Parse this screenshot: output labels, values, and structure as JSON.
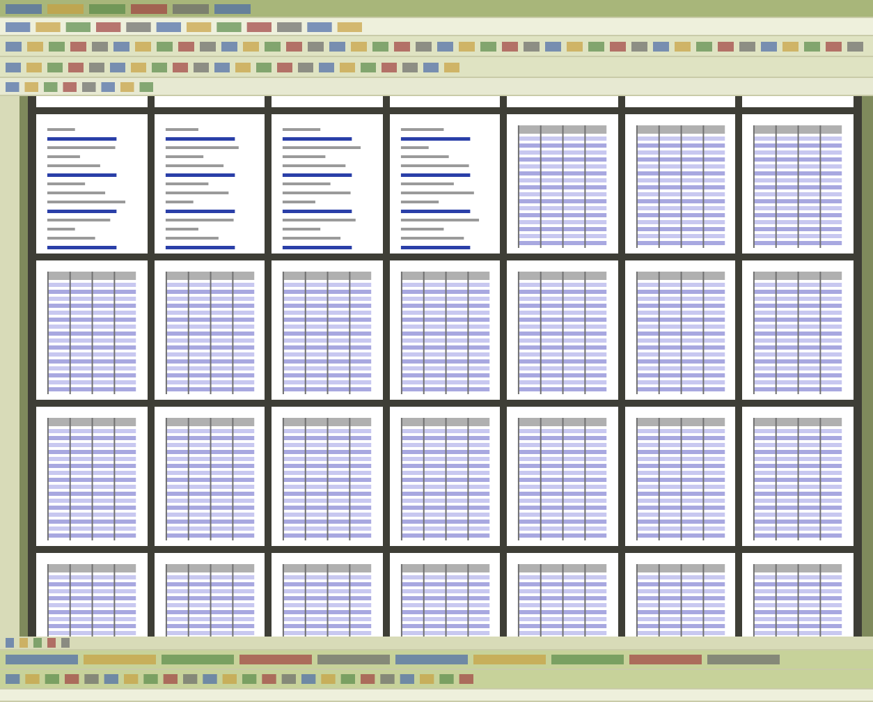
{
  "page_rows": [
    {
      "kind": "top",
      "pages": [
        {
          "kind": "blank"
        },
        {
          "kind": "blank"
        },
        {
          "kind": "blank"
        },
        {
          "kind": "blank"
        },
        {
          "kind": "blank"
        },
        {
          "kind": "blank"
        },
        {
          "kind": "blank"
        }
      ]
    },
    {
      "kind": "full",
      "pages": [
        {
          "kind": "text"
        },
        {
          "kind": "text"
        },
        {
          "kind": "text"
        },
        {
          "kind": "text"
        },
        {
          "kind": "table"
        },
        {
          "kind": "table"
        },
        {
          "kind": "table"
        }
      ]
    },
    {
      "kind": "full",
      "pages": [
        {
          "kind": "table"
        },
        {
          "kind": "table"
        },
        {
          "kind": "table"
        },
        {
          "kind": "table"
        },
        {
          "kind": "table"
        },
        {
          "kind": "table"
        },
        {
          "kind": "table"
        }
      ]
    },
    {
      "kind": "full",
      "pages": [
        {
          "kind": "table"
        },
        {
          "kind": "table"
        },
        {
          "kind": "table"
        },
        {
          "kind": "table"
        },
        {
          "kind": "table"
        },
        {
          "kind": "table"
        },
        {
          "kind": "table"
        }
      ]
    },
    {
      "kind": "bottom",
      "pages": [
        {
          "kind": "table"
        },
        {
          "kind": "table"
        },
        {
          "kind": "table"
        },
        {
          "kind": "table"
        },
        {
          "kind": "table"
        },
        {
          "kind": "table"
        },
        {
          "kind": "table"
        }
      ]
    }
  ]
}
